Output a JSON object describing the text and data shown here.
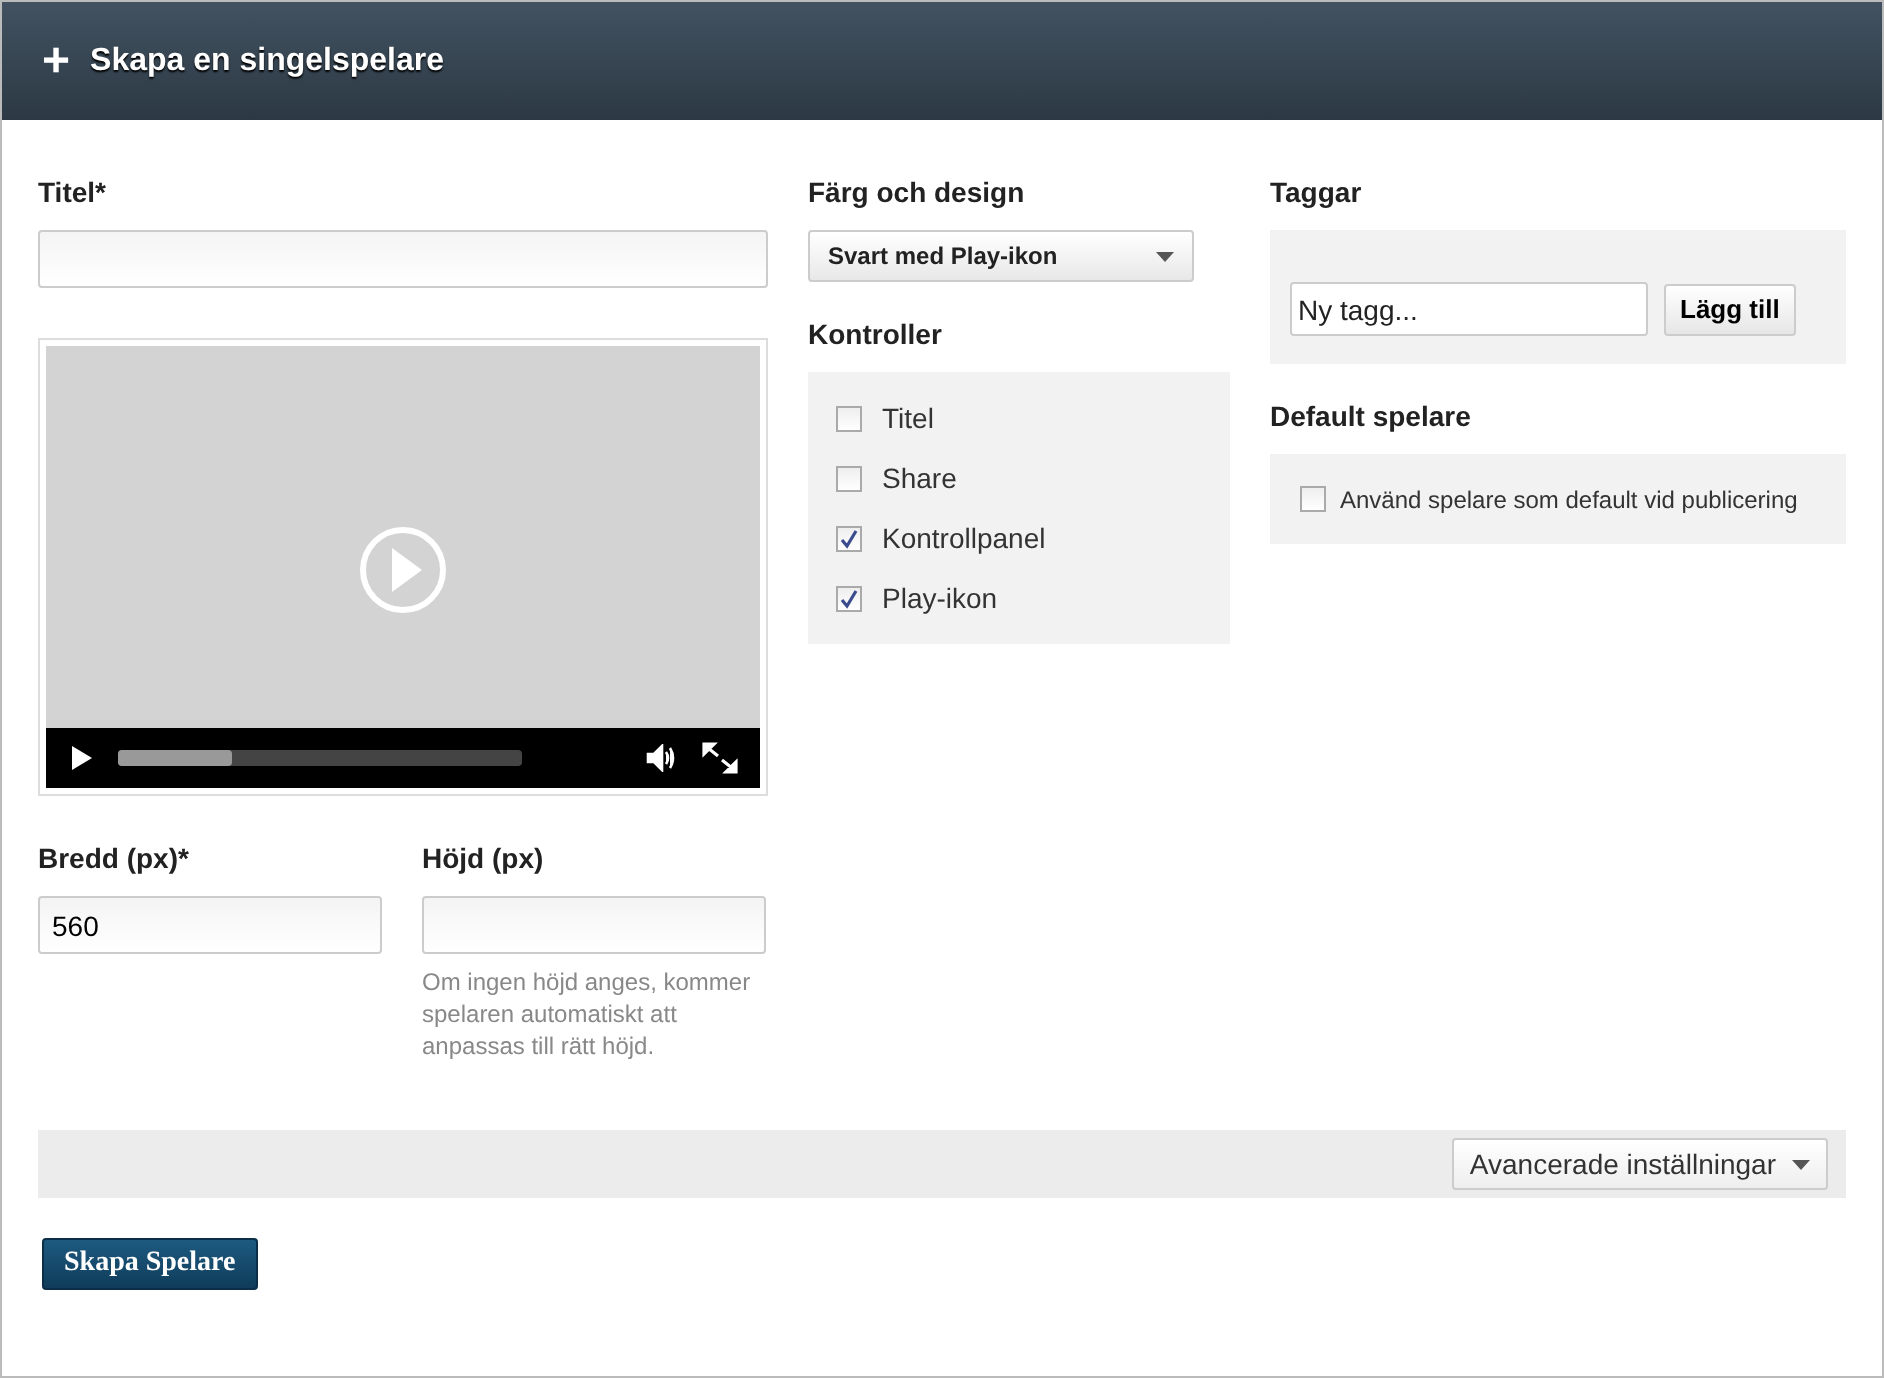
{
  "header": {
    "icon": "+",
    "title": "Skapa en singelspelare"
  },
  "title_field": {
    "label": "Titel*"
  },
  "player": {
    "progress": {
      "level": 0.28
    }
  },
  "width_field": {
    "label": "Bredd (px)*",
    "value": "560"
  },
  "height_field": {
    "label": "Höjd (px)",
    "help": "Om ingen höjd anges, kommer spelaren automatiskt att anpassas till rätt höjd."
  },
  "design": {
    "label": "Färg och design",
    "value": "Svart med Play-ikon"
  },
  "controls": {
    "label": "Kontroller",
    "items": [
      {
        "label": "Titel",
        "checked": false
      },
      {
        "label": "Share",
        "checked": false
      },
      {
        "label": "Kontrollpanel",
        "checked": true
      },
      {
        "label": "Play-ikon",
        "checked": true
      }
    ]
  },
  "tags": {
    "label": "Taggar",
    "placeholder": "Ny tagg...",
    "button": "Lägg till"
  },
  "default_player": {
    "label": "Default spelare",
    "option": {
      "label": "Använd spelare som default vid publicering",
      "checked": false
    }
  },
  "advanced": {
    "label": "Avancerade inställningar"
  },
  "submit": {
    "label": "Skapa Spelare"
  }
}
